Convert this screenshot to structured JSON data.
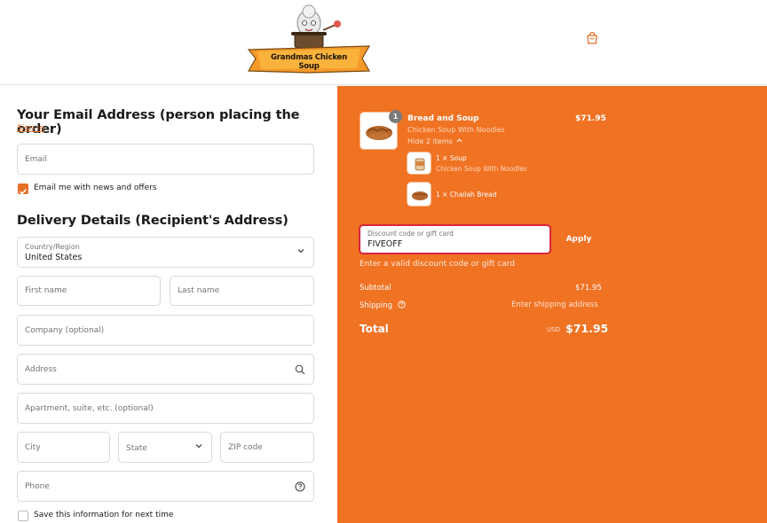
{
  "brand": {
    "name": "Grandmas Chicken Soup"
  },
  "header": {
    "cart_icon": "shopping-bag-icon"
  },
  "contact": {
    "title": "Your Email Address (person placing the order)",
    "signin_label": "Sign in",
    "email_placeholder": "Email",
    "news_checkbox_label": "Email me with news and offers",
    "news_checked": true
  },
  "delivery": {
    "title": "Delivery Details (Recipient's Address)",
    "country_label": "Country/Region",
    "country_value": "United States",
    "first_name_placeholder": "First name",
    "last_name_placeholder": "Last name",
    "company_placeholder": "Company (optional)",
    "address_placeholder": "Address",
    "apartment_placeholder": "Apartment, suite, etc. (optional)",
    "city_placeholder": "City",
    "state_label": "State",
    "zip_placeholder": "ZIP code",
    "phone_placeholder": "Phone",
    "save_label": "Save this information for next time",
    "save_checked": false
  },
  "summary": {
    "item": {
      "quantity": "1",
      "title": "Bread and Soup",
      "subtitle": "Chicken Soup With Noodles",
      "price": "$71.95",
      "toggle_label": "Hide 2 items"
    },
    "subitems": [
      {
        "label": "1 × Soup",
        "detail": "Chicken Soup With Noodles"
      },
      {
        "label": "1 × Challah Bread",
        "detail": ""
      }
    ],
    "discount_label": "Discount code or gift card",
    "discount_value": "FIVEOFF",
    "apply_label": "Apply",
    "error": "Enter a valid discount code or gift card",
    "subtotal_label": "Subtotal",
    "subtotal_value": "$71.95",
    "shipping_label": "Shipping",
    "shipping_value": "Enter shipping address",
    "total_label": "Total",
    "currency": "USD",
    "total_value": "$71.95"
  },
  "colors": {
    "accent": "#f07223",
    "link": "#e87026",
    "error_border": "#d7263d"
  }
}
